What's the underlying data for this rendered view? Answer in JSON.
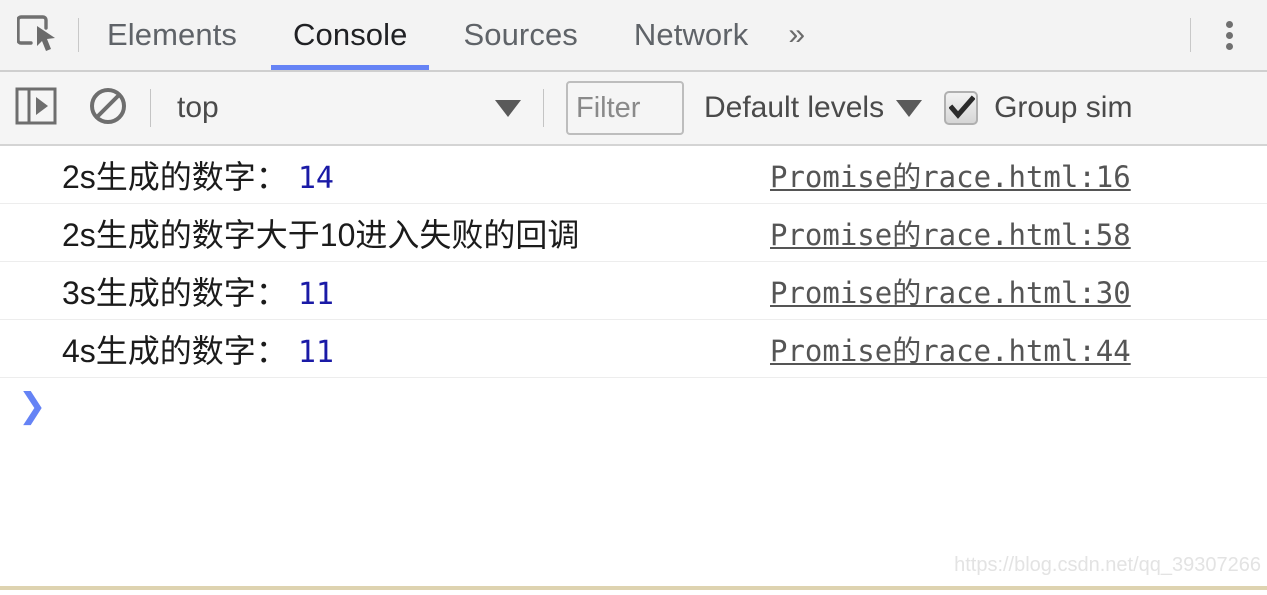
{
  "tabbar": {
    "inspect_icon": "inspect-cursor-icon",
    "tabs": [
      {
        "label": "Elements",
        "active": false
      },
      {
        "label": "Console",
        "active": true
      },
      {
        "label": "Sources",
        "active": false
      },
      {
        "label": "Network",
        "active": false
      }
    ],
    "more_tabs_glyph": "»",
    "kebab_icon": "more-options-icon",
    "active_tab_color": "#6583f5"
  },
  "filterbar": {
    "sidebar_toggle_icon": "show-console-sidebar-icon",
    "clear_icon": "clear-console-icon",
    "context": {
      "selected": "top",
      "caret_glyph": "▼"
    },
    "filter": {
      "value": "",
      "placeholder": "Filter"
    },
    "levels": {
      "label": "Default levels",
      "caret_glyph": "▼"
    },
    "group_similar": {
      "label": "Group sim",
      "checked": true,
      "checkbox_icon": "checkmark-icon"
    }
  },
  "console": {
    "rows": [
      {
        "message": "2s生成的数字：",
        "value": "14",
        "source": "Promise的race.html:16"
      },
      {
        "message": "2s生成的数字大于10进入失败的回调",
        "value": "",
        "source": "Promise的race.html:58"
      },
      {
        "message": "3s生成的数字：",
        "value": "11",
        "source": "Promise的race.html:30"
      },
      {
        "message": "4s生成的数字：",
        "value": "11",
        "source": "Promise的race.html:44"
      }
    ],
    "prompt_glyph": "❯",
    "prompt_input_value": "",
    "number_color": "#1a1aa6",
    "source_link_color": "#555555"
  },
  "watermark": {
    "text": "https://blog.csdn.net/qq_39307266"
  }
}
